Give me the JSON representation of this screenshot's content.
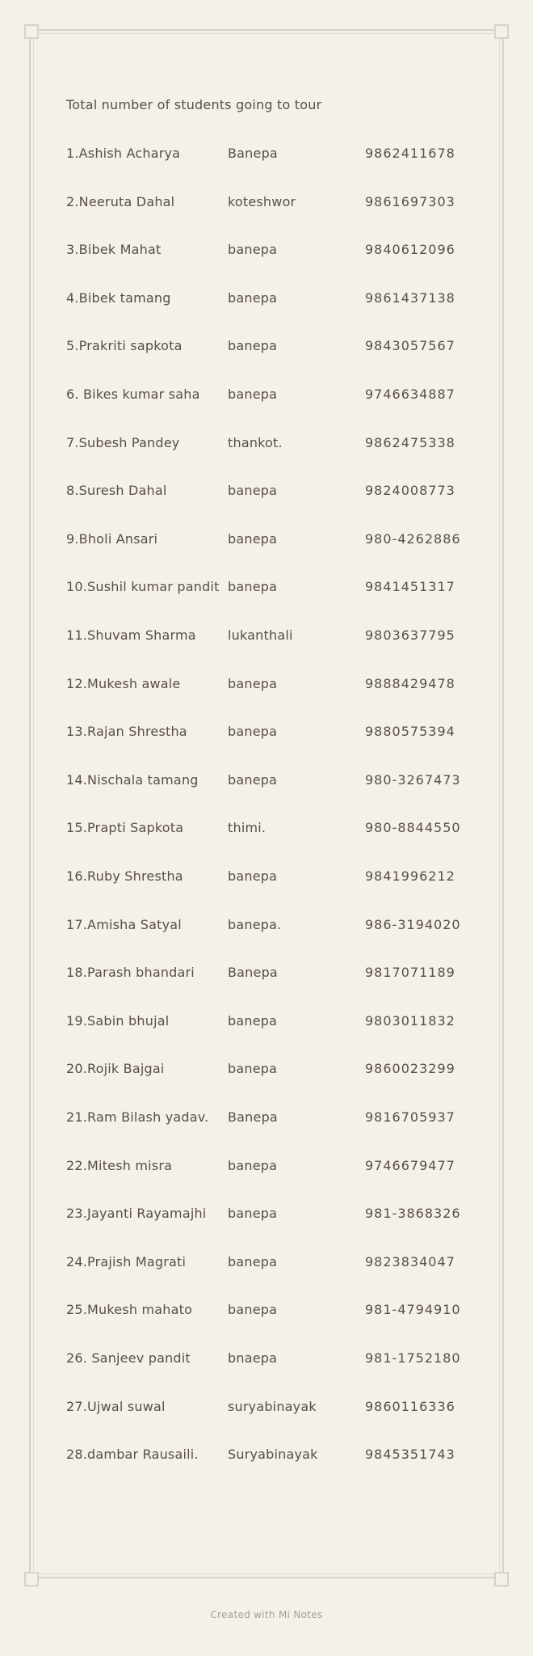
{
  "note": {
    "heading": "Total number of students going to tour",
    "rows": [
      {
        "name": "1.Ashish Acharya",
        "place": "Banepa",
        "phone": "9862411678"
      },
      {
        "name": "2.Neeruta Dahal",
        "place": "koteshwor",
        "phone": "9861697303"
      },
      {
        "name": "3.Bibek Mahat",
        "place": "banepa",
        "phone": "9840612096"
      },
      {
        "name": "4.Bibek tamang",
        "place": "banepa",
        "phone": "9861437138"
      },
      {
        "name": "5.Prakriti sapkota",
        "place": "banepa",
        "phone": "9843057567"
      },
      {
        "name": "6. Bikes kumar saha",
        "place": "banepa",
        "phone": "9746634887"
      },
      {
        "name": "7.Subesh Pandey",
        "place": "thankot.",
        "phone": "9862475338"
      },
      {
        "name": "8.Suresh Dahal",
        "place": "banepa",
        "phone": "9824008773"
      },
      {
        "name": "9.Bholi Ansari",
        "place": "banepa",
        "phone": "980-4262886"
      },
      {
        "name": "10.Sushil kumar pandit",
        "place": "banepa",
        "phone": "9841451317"
      },
      {
        "name": "11.Shuvam Sharma",
        "place": "lukanthali",
        "phone": "9803637795"
      },
      {
        "name": "12.Mukesh awale",
        "place": "banepa",
        "phone": "9888429478"
      },
      {
        "name": "13.Rajan Shrestha",
        "place": "banepa",
        "phone": "9880575394"
      },
      {
        "name": "14.Nischala tamang",
        "place": "banepa",
        "phone": "980-3267473"
      },
      {
        "name": "15.Prapti Sapkota",
        "place": "thimi.",
        "phone": "980-8844550"
      },
      {
        "name": "16.Ruby Shrestha",
        "place": "banepa",
        "phone": "9841996212"
      },
      {
        "name": "17.Amisha Satyal",
        "place": "banepa.",
        "phone": "986-3194020"
      },
      {
        "name": "18.Parash  bhandari",
        "place": "Banepa",
        "phone": "9817071189"
      },
      {
        "name": "19.Sabin bhujal",
        "place": "banepa",
        "phone": "9803011832"
      },
      {
        "name": "20.Rojik Bajgai",
        "place": "banepa",
        "phone": "9860023299"
      },
      {
        "name": "21.Ram Bilash yadav.",
        "place": "Banepa",
        "phone": "9816705937"
      },
      {
        "name": "22.Mitesh misra",
        "place": "banepa",
        "phone": "9746679477"
      },
      {
        "name": "23.Jayanti  Rayamajhi",
        "place": "banepa",
        "phone": "981-3868326"
      },
      {
        "name": "24.Prajish Magrati",
        "place": "banepa",
        "phone": "9823834047"
      },
      {
        "name": "25.Mukesh mahato",
        "place": "banepa",
        "phone": "981-4794910"
      },
      {
        "name": "26. Sanjeev pandit",
        "place": "bnaepa",
        "phone": "981-1752180"
      },
      {
        "name": "27.Ujwal suwal",
        "place": "suryabinayak",
        "phone": "9860116336"
      },
      {
        "name": "28.dambar Rausaili.",
        "place": "Suryabinayak",
        "phone": "9845351743"
      }
    ]
  },
  "footer": {
    "label": "Created with Mi Notes"
  }
}
